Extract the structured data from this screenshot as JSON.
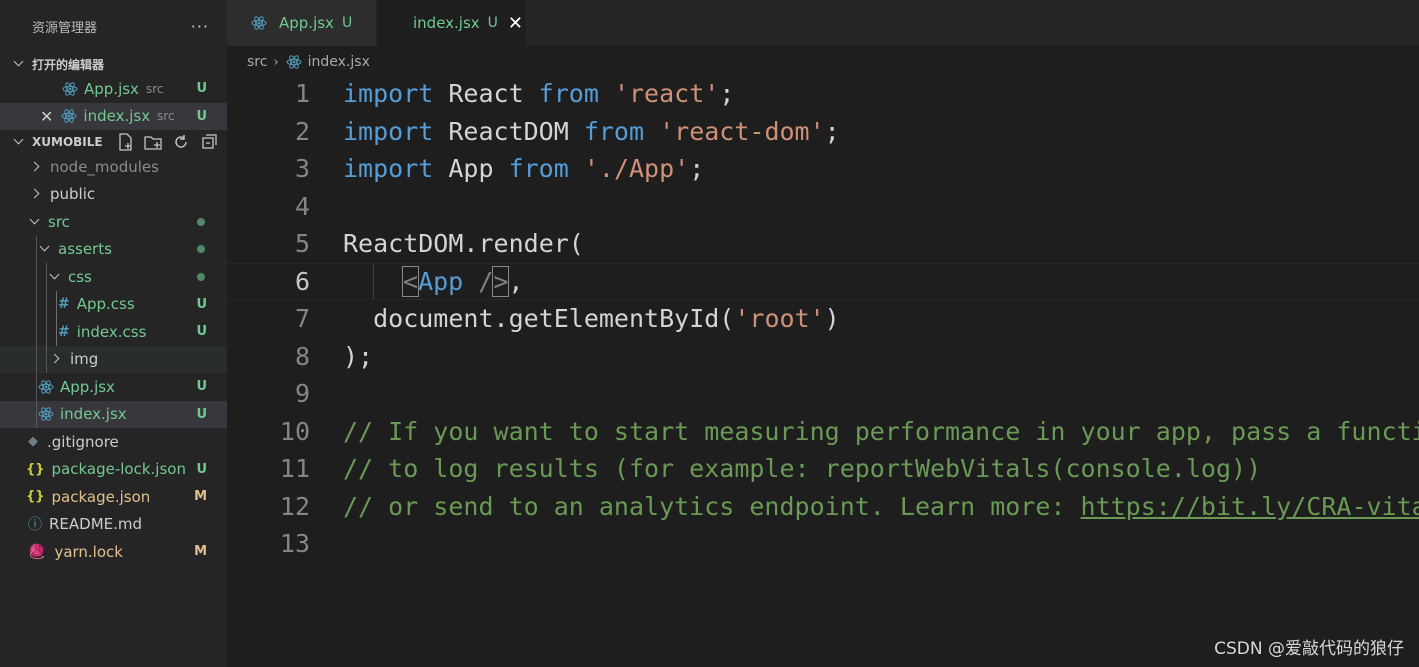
{
  "explorer": {
    "title": "资源管理器",
    "more": "···",
    "open_editors": {
      "label": "打开的编辑器",
      "items": [
        {
          "name": "App.jsx",
          "desc": "src",
          "badge": "U"
        },
        {
          "name": "index.jsx",
          "desc": "src",
          "badge": "U"
        }
      ]
    },
    "project": {
      "label": "XUMOBILE",
      "tree": [
        {
          "name": "node_modules"
        },
        {
          "name": "public"
        },
        {
          "name": "src"
        },
        {
          "name": "asserts"
        },
        {
          "name": "css"
        },
        {
          "name": "App.css",
          "badge": "U"
        },
        {
          "name": "index.css",
          "badge": "U"
        },
        {
          "name": "img"
        },
        {
          "name": "App.jsx",
          "badge": "U"
        },
        {
          "name": "index.jsx",
          "badge": "U"
        },
        {
          "name": ".gitignore"
        },
        {
          "name": "package-lock.json",
          "badge": "U"
        },
        {
          "name": "package.json",
          "badge": "M"
        },
        {
          "name": "README.md"
        },
        {
          "name": "yarn.lock",
          "badge": "M"
        }
      ]
    }
  },
  "tabs": [
    {
      "label": "App.jsx",
      "badge": "U"
    },
    {
      "label": "index.jsx",
      "badge": "U",
      "close": "✕"
    }
  ],
  "breadcrumb": {
    "folder": "src",
    "file": "index.jsx"
  },
  "code": {
    "line_numbers": [
      "1",
      "2",
      "3",
      "4",
      "5",
      "6",
      "7",
      "8",
      "9",
      "10",
      "11",
      "12",
      "13"
    ],
    "l1": {
      "kw1": "import",
      "id": " React ",
      "kw2": "from",
      "str": " 'react'",
      "end": ";"
    },
    "l2": {
      "kw1": "import",
      "id": " ReactDOM ",
      "kw2": "from",
      "str": " 'react-dom'",
      "end": ";"
    },
    "l3": {
      "kw1": "import",
      "id": " App ",
      "kw2": "from",
      "str": " './App'",
      "end": ";"
    },
    "l5": {
      "obj": "ReactDOM",
      "dot": ".",
      "fn": "render",
      "paren": "("
    },
    "l6": {
      "lt": "<",
      "tag": "App",
      "slash": " /",
      "gt": ">",
      "comma": ","
    },
    "l7": {
      "obj": "  document",
      "dot": ".",
      "fn": "getElementById",
      "open": "(",
      "str": "'root'",
      "close": ")"
    },
    "l8": {
      "text": ");"
    },
    "l10": {
      "text": "// If you want to start measuring performance in your app, pass a functi"
    },
    "l11": {
      "text": "// to log results (for example: reportWebVitals(console.log))"
    },
    "l12": {
      "text": "// or send to an analytics endpoint. Learn more: ",
      "link": "https://bit.ly/CRA-vita"
    }
  },
  "watermark": "CSDN @爱敲代码的狼仔",
  "colors": {
    "keyword": "#569cd6",
    "string": "#ce9178",
    "function": "#dcdcaa",
    "comment": "#6a9955",
    "untracked": "#73c991",
    "modified": "#e2c08d"
  }
}
